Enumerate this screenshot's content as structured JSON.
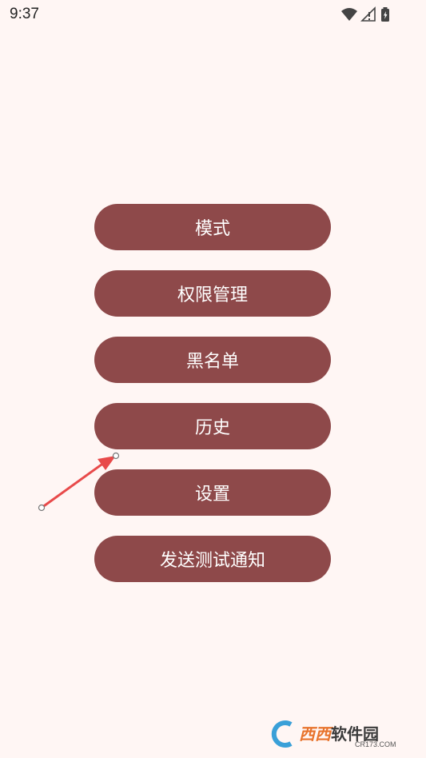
{
  "status_bar": {
    "time": "9:37"
  },
  "menu": {
    "items": [
      {
        "label": "模式"
      },
      {
        "label": "权限管理"
      },
      {
        "label": "黑名单"
      },
      {
        "label": "历史"
      },
      {
        "label": "设置"
      },
      {
        "label": "发送测试通知"
      }
    ]
  },
  "colors": {
    "background": "#fff6f4",
    "button": "#8e494a",
    "button_text": "#ffffff",
    "annotation_arrow": "#e84a4a"
  },
  "watermark": {
    "logo": "西西",
    "text": "软件园",
    "sub": "CR173.COM"
  }
}
